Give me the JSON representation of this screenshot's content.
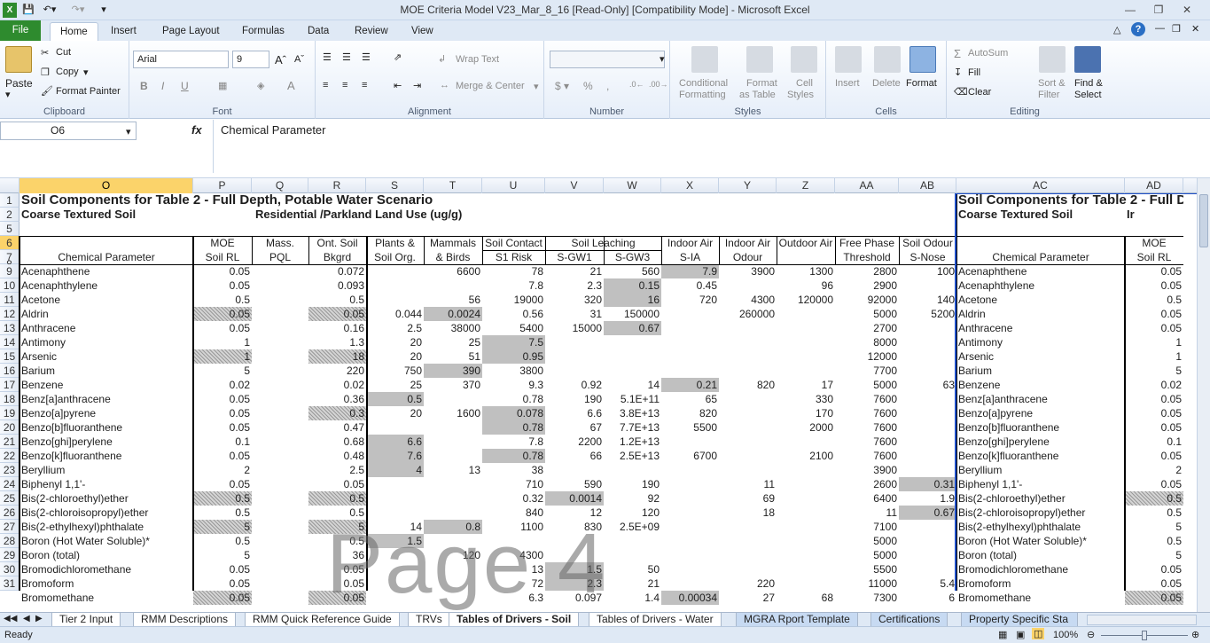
{
  "window": {
    "title": "MOE Criteria Model V23_Mar_8_16  [Read-Only]  [Compatibility Mode]  -  Microsoft Excel"
  },
  "ribbon_tabs": [
    "File",
    "Home",
    "Insert",
    "Page Layout",
    "Formulas",
    "Data",
    "Review",
    "View"
  ],
  "clipboard": {
    "paste": "Paste",
    "cut": "Cut",
    "copy": "Copy",
    "format_painter": "Format Painter",
    "label": "Clipboard"
  },
  "font": {
    "name": "Arial",
    "size": "9",
    "label": "Font"
  },
  "alignment": {
    "wrap": "Wrap Text",
    "merge": "Merge & Center",
    "label": "Alignment"
  },
  "number": {
    "label": "Number"
  },
  "styles": {
    "conditional": "Conditional",
    "formatting": "Formatting",
    "format_as": "Format",
    "as_table": "as Table",
    "cell": "Cell",
    "cell_styles": "Styles",
    "label": "Styles"
  },
  "cells": {
    "insert": "Insert",
    "delete": "Delete",
    "format": "Format",
    "label": "Cells"
  },
  "editing": {
    "autosum": "AutoSum",
    "fill": "Fill",
    "clear": "Clear",
    "sort": "Sort &",
    "filter": "Filter",
    "find": "Find &",
    "select": "Select",
    "label": "Editing"
  },
  "formula_bar": {
    "name_box": "O6",
    "content": "Chemical Parameter"
  },
  "columns": [
    "O",
    "P",
    "Q",
    "R",
    "S",
    "T",
    "U",
    "V",
    "W",
    "X",
    "Y",
    "Z",
    "AA",
    "AB",
    "AC",
    "AD"
  ],
  "rows": [
    "1",
    "2",
    "5",
    "6",
    "7",
    "8",
    "9",
    "10",
    "11",
    "12",
    "13",
    "14",
    "15",
    "16",
    "17",
    "18",
    "19",
    "20",
    "21",
    "22",
    "23",
    "24",
    "25",
    "26",
    "27",
    "28",
    "29",
    "30",
    "31"
  ],
  "header": {
    "r1": "Soil Components for Table 2 - Full Depth, Potable Water Scenario",
    "r2a": "Coarse Textured Soil",
    "r2b": "Residential /Parkland Land Use (ug/g)",
    "r1_right": "Soil Components for Table 2 - Full D",
    "r2_right": "Coarse Textured Soil",
    "r2_right2": "Ir",
    "h5": [
      "",
      "MOE",
      "Mass.",
      "Ont. Soil",
      "Plants &",
      "Mammals",
      "Soil Contact",
      "Soil Leaching",
      "",
      "Indoor Air",
      "Indoor Air",
      "Outdoor Air",
      "Free Phase",
      "Soil Odour",
      "",
      "MOE"
    ],
    "h6": [
      "Chemical Parameter",
      "Soil RL",
      "PQL",
      "Bkgrd",
      "Soil Org.",
      "& Birds",
      "S1 Risk",
      "S-GW1",
      "S-GW3",
      "S-IA",
      "Odour",
      "",
      "Threshold",
      "S-Nose",
      "Chemical Parameter",
      "Soil RL"
    ]
  },
  "data_rows": [
    [
      "Acenaphthene",
      "0.05",
      "",
      "0.072",
      "",
      "6600",
      "78",
      "21",
      "560",
      "7.9",
      "3900",
      "1300",
      "2800",
      "100",
      "Acenaphthene",
      "0.05"
    ],
    [
      "Acenaphthylene",
      "0.05",
      "",
      "0.093",
      "",
      "",
      "7.8",
      "2.3",
      "0.15",
      "0.45",
      "",
      "96",
      "2900",
      "",
      "Acenaphthylene",
      "0.05"
    ],
    [
      "Acetone",
      "0.5",
      "",
      "0.5",
      "",
      "56",
      "19000",
      "320",
      "16",
      "720",
      "4300",
      "120000",
      "92000",
      "140",
      "Acetone",
      "0.5"
    ],
    [
      "Aldrin",
      "0.05",
      "",
      "0.05",
      "0.044",
      "0.0024",
      "0.56",
      "31",
      "150000",
      "",
      "260000",
      "",
      "5000",
      "5200",
      "Aldrin",
      "0.05"
    ],
    [
      "Anthracene",
      "0.05",
      "",
      "0.16",
      "2.5",
      "38000",
      "5400",
      "15000",
      "0.67",
      "",
      "",
      "",
      "2700",
      "",
      "Anthracene",
      "0.05"
    ],
    [
      "Antimony",
      "1",
      "",
      "1.3",
      "20",
      "25",
      "7.5",
      "",
      "",
      "",
      "",
      "",
      "8000",
      "",
      "Antimony",
      "1"
    ],
    [
      "Arsenic",
      "1",
      "",
      "18",
      "20",
      "51",
      "0.95",
      "",
      "",
      "",
      "",
      "",
      "12000",
      "",
      "Arsenic",
      "1"
    ],
    [
      "Barium",
      "5",
      "",
      "220",
      "750",
      "390",
      "3800",
      "",
      "",
      "",
      "",
      "",
      "7700",
      "",
      "Barium",
      "5"
    ],
    [
      "Benzene",
      "0.02",
      "",
      "0.02",
      "25",
      "370",
      "9.3",
      "0.92",
      "14",
      "0.21",
      "820",
      "17",
      "5000",
      "63",
      "Benzene",
      "0.02"
    ],
    [
      "Benz[a]anthracene",
      "0.05",
      "",
      "0.36",
      "0.5",
      "",
      "0.78",
      "190",
      "5.1E+11",
      "65",
      "",
      "330",
      "7600",
      "",
      "Benz[a]anthracene",
      "0.05"
    ],
    [
      "Benzo[a]pyrene",
      "0.05",
      "",
      "0.3",
      "20",
      "1600",
      "0.078",
      "6.6",
      "3.8E+13",
      "820",
      "",
      "170",
      "7600",
      "",
      "Benzo[a]pyrene",
      "0.05"
    ],
    [
      "Benzo[b]fluoranthene",
      "0.05",
      "",
      "0.47",
      "",
      "",
      "0.78",
      "67",
      "7.7E+13",
      "5500",
      "",
      "2000",
      "7600",
      "",
      "Benzo[b]fluoranthene",
      "0.05"
    ],
    [
      "Benzo[ghi]perylene",
      "0.1",
      "",
      "0.68",
      "6.6",
      "",
      "7.8",
      "2200",
      "1.2E+13",
      "",
      "",
      "",
      "7600",
      "",
      "Benzo[ghi]perylene",
      "0.1"
    ],
    [
      "Benzo[k]fluoranthene",
      "0.05",
      "",
      "0.48",
      "7.6",
      "",
      "0.78",
      "66",
      "2.5E+13",
      "6700",
      "",
      "2100",
      "7600",
      "",
      "Benzo[k]fluoranthene",
      "0.05"
    ],
    [
      "Beryllium",
      "2",
      "",
      "2.5",
      "4",
      "13",
      "38",
      "",
      "",
      "",
      "",
      "",
      "3900",
      "",
      "Beryllium",
      "2"
    ],
    [
      "Biphenyl 1,1'-",
      "0.05",
      "",
      "0.05",
      "",
      "",
      "710",
      "590",
      "190",
      "",
      "11",
      "",
      "2600",
      "0.31",
      "Biphenyl 1,1'-",
      "0.05"
    ],
    [
      "Bis(2-chloroethyl)ether",
      "0.5",
      "",
      "0.5",
      "",
      "",
      "0.32",
      "0.0014",
      "92",
      "",
      "69",
      "",
      "6400",
      "1.9",
      "Bis(2-chloroethyl)ether",
      "0.5"
    ],
    [
      "Bis(2-chloroisopropyl)ether",
      "0.5",
      "",
      "0.5",
      "",
      "",
      "840",
      "12",
      "120",
      "",
      "18",
      "",
      "11",
      "0.67",
      "Bis(2-chloroisopropyl)ether",
      "0.5"
    ],
    [
      "Bis(2-ethylhexyl)phthalate",
      "5",
      "",
      "5",
      "14",
      "0.8",
      "1100",
      "830",
      "2.5E+09",
      "",
      "",
      "",
      "7100",
      "",
      "Bis(2-ethylhexyl)phthalate",
      "5"
    ],
    [
      "Boron (Hot Water Soluble)*",
      "0.5",
      "",
      "0.5",
      "1.5",
      "",
      "",
      "",
      "",
      "",
      "",
      "",
      "5000",
      "",
      "Boron (Hot Water Soluble)*",
      "0.5"
    ],
    [
      "Boron (total)",
      "5",
      "",
      "36",
      "",
      "120",
      "4300",
      "",
      "",
      "",
      "",
      "",
      "5000",
      "",
      "Boron (total)",
      "5"
    ],
    [
      "Bromodichloromethane",
      "0.05",
      "",
      "0.05",
      "",
      "",
      "13",
      "1.5",
      "50",
      "",
      "",
      "",
      "5500",
      "",
      "Bromodichloromethane",
      "0.05"
    ],
    [
      "Bromoform",
      "0.05",
      "",
      "0.05",
      "",
      "",
      "72",
      "2.3",
      "21",
      "",
      "220",
      "",
      "11000",
      "5.4",
      "Bromoform",
      "0.05"
    ],
    [
      "Bromomethane",
      "0.05",
      "",
      "0.05",
      "",
      "",
      "6.3",
      "0.097",
      "1.4",
      "0.00034",
      "27",
      "68",
      "7300",
      "6",
      "Bromomethane",
      "0.05"
    ]
  ],
  "gray_cells": [
    "0-9",
    "1-8",
    "2-8",
    "3-5",
    "4-8",
    "5-6",
    "6-6",
    "7-5",
    "8-9",
    "9-4",
    "10-6",
    "11-6",
    "12-4",
    "13-4",
    "13-6",
    "14-4",
    "15-13",
    "16-7",
    "17-13",
    "18-5",
    "19-4",
    "21-7",
    "22-7",
    "23-9"
  ],
  "dotted_cells": [
    "3-1",
    "3-3",
    "6-1",
    "6-3",
    "10-3",
    "16-1",
    "16-3",
    "18-1",
    "18-3",
    "23-1",
    "23-3",
    "16-15",
    "23-15"
  ],
  "watermark": "Page 4",
  "sheet_tabs": [
    "Tier 2 Input",
    "RMM Descriptions",
    "RMM Quick Reference Guide",
    "TRVs",
    "Tables of Drivers - Soil",
    "Tables of Drivers - Water",
    "MGRA Rport Template",
    "Certifications",
    "Property Specific Sta"
  ],
  "status": {
    "ready": "Ready",
    "zoom": "100%"
  }
}
